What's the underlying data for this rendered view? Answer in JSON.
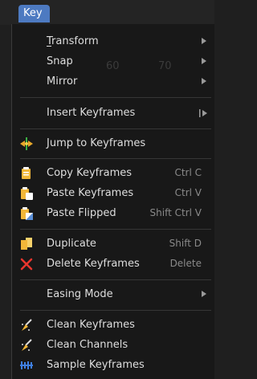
{
  "menubar": {
    "tab_label": "Key"
  },
  "background_ticks": [
    "60",
    "70"
  ],
  "menu": {
    "items": [
      {
        "label": "Transform",
        "shortcut": "",
        "submenu": true,
        "icon": ""
      },
      {
        "label": "Snap",
        "shortcut": "",
        "submenu": true,
        "icon": ""
      },
      {
        "label": "Mirror",
        "shortcut": "",
        "submenu": true,
        "icon": ""
      },
      {
        "label": "Insert Keyframes",
        "shortcut": "",
        "submenu": true,
        "icon": ""
      },
      {
        "label": "Jump to Keyframes",
        "shortcut": "",
        "submenu": false,
        "icon": "jump-keyframes-icon"
      },
      {
        "label": "Copy Keyframes",
        "shortcut": "Ctrl C",
        "submenu": false,
        "icon": "copy-icon"
      },
      {
        "label": "Paste Keyframes",
        "shortcut": "Ctrl V",
        "submenu": false,
        "icon": "paste-icon"
      },
      {
        "label": "Paste Flipped",
        "shortcut": "Shift Ctrl V",
        "submenu": false,
        "icon": "paste-flipped-icon"
      },
      {
        "label": "Duplicate",
        "shortcut": "Shift D",
        "submenu": false,
        "icon": "duplicate-icon"
      },
      {
        "label": "Delete Keyframes",
        "shortcut": "Delete",
        "submenu": false,
        "icon": "delete-x-icon"
      },
      {
        "label": "Easing Mode",
        "shortcut": "",
        "submenu": true,
        "icon": ""
      },
      {
        "label": "Clean Keyframes",
        "shortcut": "",
        "submenu": false,
        "icon": "clean-brush-icon"
      },
      {
        "label": "Clean Channels",
        "shortcut": "",
        "submenu": false,
        "icon": "clean-brush-icon"
      },
      {
        "label": "Sample Keyframes",
        "shortcut": "",
        "submenu": false,
        "icon": "sample-keyframes-icon"
      }
    ]
  },
  "colors": {
    "accent": "#4d7ac1",
    "menu_bg": "#181818",
    "shortcut_text": "#8a8a8a",
    "delete_red": "#e8362e"
  }
}
